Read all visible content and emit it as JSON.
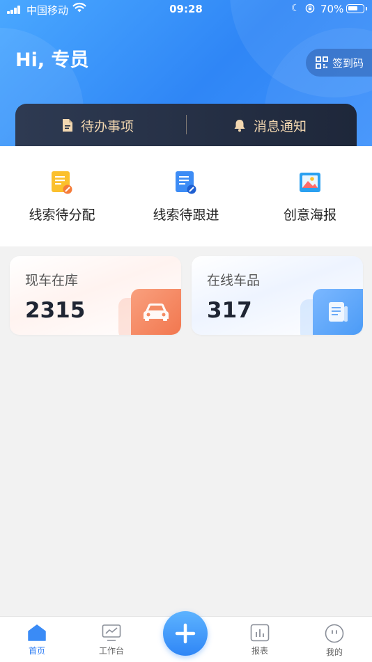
{
  "status_bar": {
    "carrier": "中国移动",
    "time": "09:28",
    "battery_text": "70%",
    "battery_level": 0.7
  },
  "header": {
    "greeting": "Hi, 专员",
    "checkin_label": "签到码",
    "todo_label": "待办事项",
    "notice_label": "消息通知"
  },
  "quick_actions": [
    {
      "label": "线索待分配",
      "icon": "clue-assign-icon"
    },
    {
      "label": "线索待跟进",
      "icon": "clue-follow-icon"
    },
    {
      "label": "创意海报",
      "icon": "poster-icon"
    }
  ],
  "stats": [
    {
      "title": "现车在库",
      "value": "2315",
      "icon": "car-icon",
      "accent": "#f2774f"
    },
    {
      "title": "在线车品",
      "value": "317",
      "icon": "document-icon",
      "accent": "#4b9bf6"
    }
  ],
  "tabbar": {
    "items": [
      {
        "label": "首页",
        "icon": "home-icon",
        "active": true
      },
      {
        "label": "工作台",
        "icon": "workbench-icon",
        "active": false
      },
      {
        "label": "报表",
        "icon": "report-icon",
        "active": false
      },
      {
        "label": "我的",
        "icon": "profile-icon",
        "active": false
      }
    ],
    "center_icon": "plus-icon"
  },
  "colors": {
    "primary": "#2f86f6",
    "bar_dark": "#252f44",
    "bar_text": "#f2d7b0"
  }
}
